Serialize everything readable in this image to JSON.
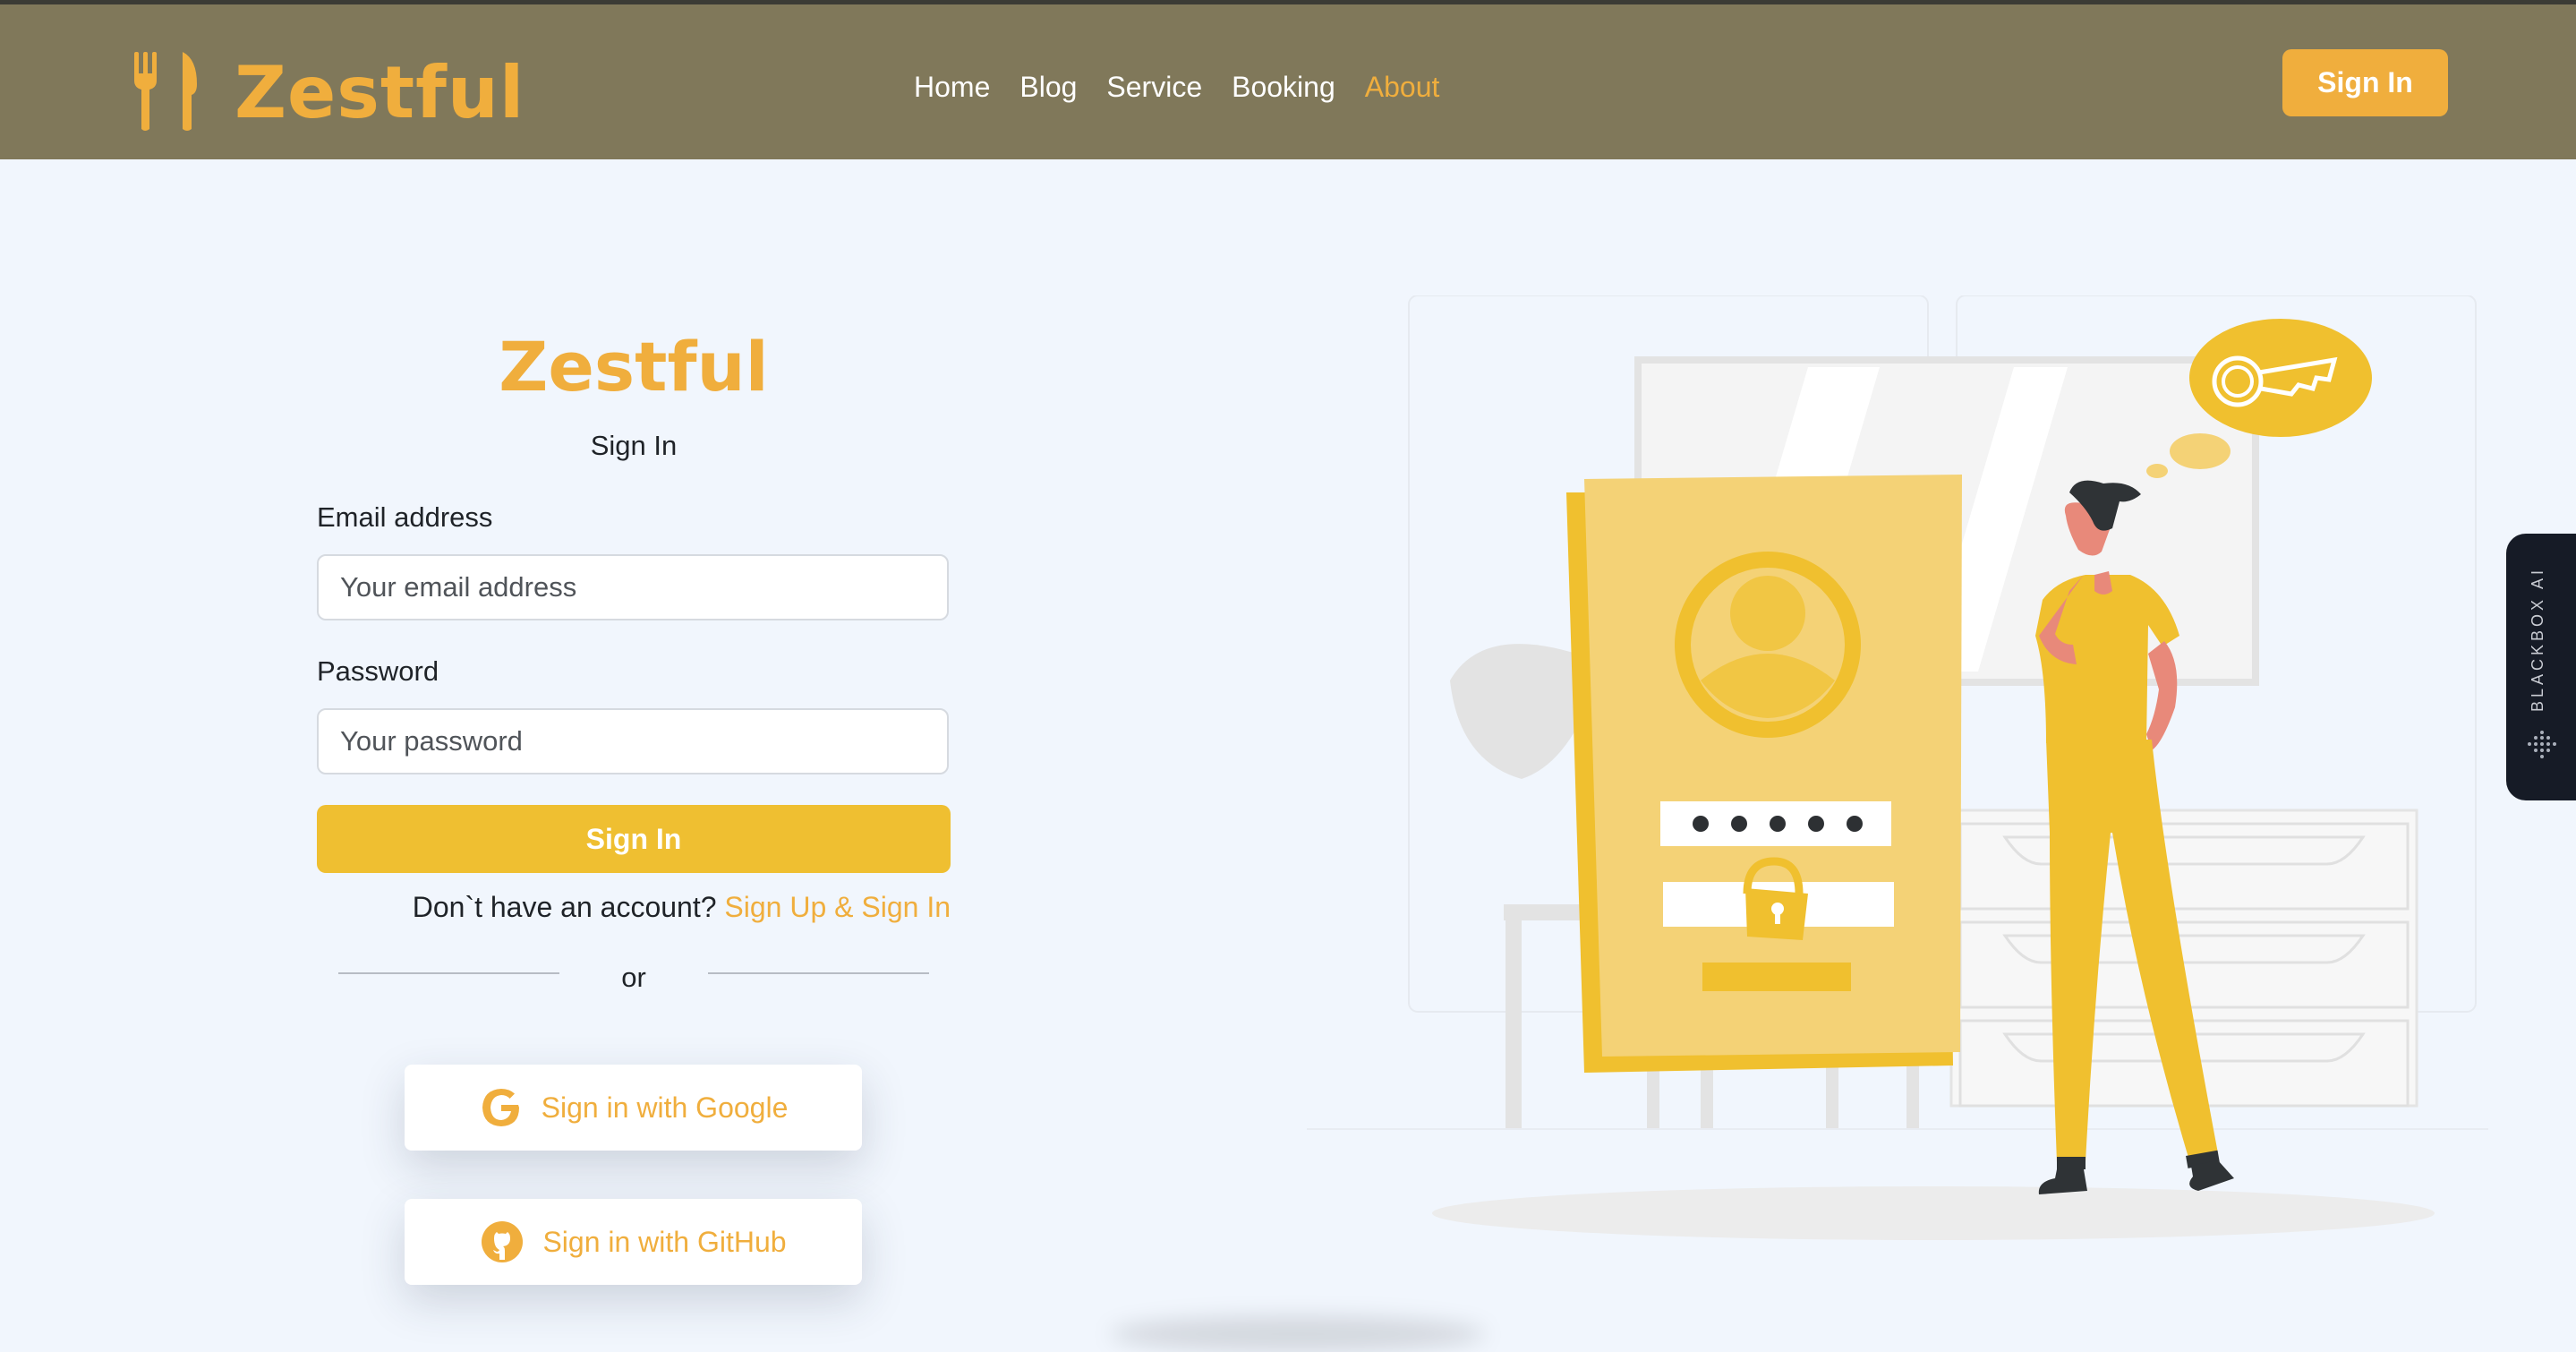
{
  "header": {
    "brand": "Zestful",
    "nav": [
      {
        "label": "Home",
        "active": false
      },
      {
        "label": "Blog",
        "active": false
      },
      {
        "label": "Service",
        "active": false
      },
      {
        "label": "Booking",
        "active": false
      },
      {
        "label": "About",
        "active": true
      }
    ],
    "signin_label": "Sign In"
  },
  "form": {
    "title": "Zestful",
    "subtitle": "Sign In",
    "email_label": "Email address",
    "email_placeholder": "Your email address",
    "email_value": "",
    "password_label": "Password",
    "password_placeholder": "Your password",
    "password_value": "",
    "submit_label": "Sign In",
    "no_account_text": "Don`t have an account?",
    "signup_link": "Sign Up & Sign In",
    "or_text": "or",
    "google_label": "Sign in with Google",
    "github_label": "Sign in with GitHub"
  },
  "side_tab": {
    "label": "BLACKBOX AI"
  },
  "icons": {
    "brand": "fork-knife-icon",
    "google": "google-icon",
    "github": "github-icon"
  },
  "colors": {
    "nav_bg": "#80785a",
    "accent": "#f0ae3d",
    "submit": "#efbf31",
    "page_bg": "#f1f6fd"
  }
}
